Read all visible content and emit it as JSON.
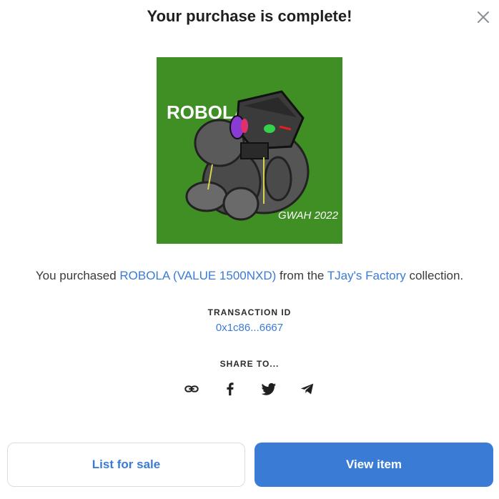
{
  "modal": {
    "title": "Your purchase is complete!",
    "close_icon": "close-icon"
  },
  "artwork": {
    "text": "ROBOLA",
    "signature": "GWAH 2022",
    "background_color": "#3f8f24"
  },
  "purchase": {
    "prefix": "You purchased ",
    "item_name": "ROBOLA (VALUE 1500NXD)",
    "middle": " from the ",
    "collection_name": "TJay's Factory",
    "suffix": " collection."
  },
  "transaction": {
    "label": "TRANSACTION ID",
    "id": "0x1c86...6667"
  },
  "share": {
    "label": "SHARE TO...",
    "icons": [
      "link-icon",
      "facebook-icon",
      "twitter-icon",
      "telegram-icon"
    ]
  },
  "actions": {
    "list_label": "List for sale",
    "view_label": "View item"
  },
  "colors": {
    "accent": "#3a7bd5"
  }
}
